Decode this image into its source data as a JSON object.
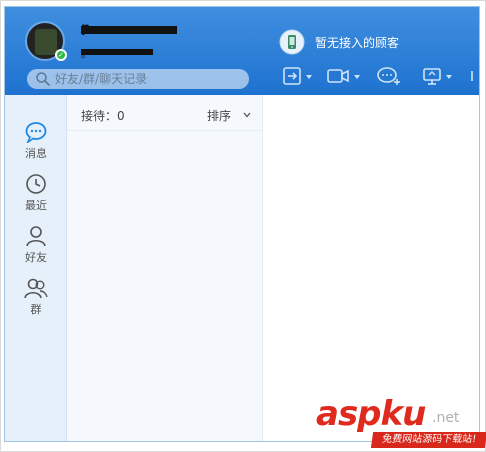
{
  "header": {
    "nickname": "p",
    "signature": "。",
    "visitor_status": "暂无接入的顾客"
  },
  "search": {
    "placeholder": "好友/群/聊天记录"
  },
  "toolbar": {
    "icons": [
      "transfer-icon",
      "video-icon",
      "chat-add-icon",
      "screen-share-icon"
    ]
  },
  "sidebar": {
    "items": [
      {
        "label": "消息",
        "icon": "message-icon",
        "active": true
      },
      {
        "label": "最近",
        "icon": "clock-icon",
        "active": false
      },
      {
        "label": "好友",
        "icon": "person-icon",
        "active": false
      },
      {
        "label": "群",
        "icon": "group-icon",
        "active": false
      }
    ]
  },
  "list": {
    "reception": "接待：0",
    "sort": "排序"
  },
  "watermark": {
    "brand_a": "asp",
    "brand_b": "ku",
    "suffix": ".net",
    "tagline": "免费网站源码下载站!"
  },
  "colors": {
    "header_start": "#3f8fe0",
    "header_end": "#1e72cf",
    "accent": "#1e88e5",
    "sidebar_bg": "#e6f0fa",
    "online": "#2fb84a",
    "watermark_red": "#e02a1e"
  }
}
